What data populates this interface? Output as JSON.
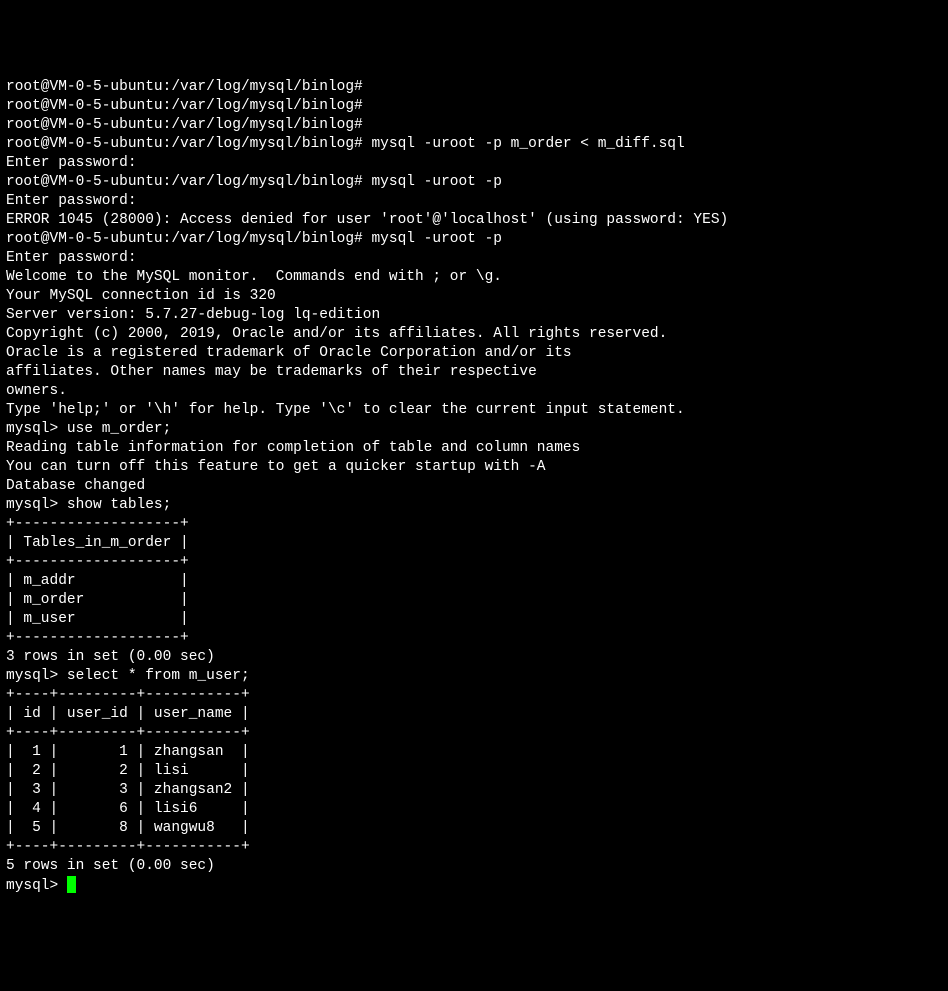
{
  "lines": [
    "root@VM-0-5-ubuntu:/var/log/mysql/binlog#",
    "root@VM-0-5-ubuntu:/var/log/mysql/binlog#",
    "root@VM-0-5-ubuntu:/var/log/mysql/binlog#",
    "root@VM-0-5-ubuntu:/var/log/mysql/binlog# mysql -uroot -p m_order < m_diff.sql",
    "Enter password:",
    "root@VM-0-5-ubuntu:/var/log/mysql/binlog# mysql -uroot -p",
    "Enter password:",
    "ERROR 1045 (28000): Access denied for user 'root'@'localhost' (using password: YES)",
    "root@VM-0-5-ubuntu:/var/log/mysql/binlog# mysql -uroot -p",
    "Enter password:",
    "Welcome to the MySQL monitor.  Commands end with ; or \\g.",
    "Your MySQL connection id is 320",
    "Server version: 5.7.27-debug-log lq-edition",
    "",
    "Copyright (c) 2000, 2019, Oracle and/or its affiliates. All rights reserved.",
    "",
    "Oracle is a registered trademark of Oracle Corporation and/or its",
    "affiliates. Other names may be trademarks of their respective",
    "owners.",
    "",
    "Type 'help;' or '\\h' for help. Type '\\c' to clear the current input statement.",
    "",
    "mysql> use m_order;",
    "Reading table information for completion of table and column names",
    "You can turn off this feature to get a quicker startup with -A",
    "",
    "Database changed",
    "mysql> show tables;",
    "+-------------------+",
    "| Tables_in_m_order |",
    "+-------------------+",
    "| m_addr            |",
    "| m_order           |",
    "| m_user            |",
    "+-------------------+",
    "3 rows in set (0.00 sec)",
    "",
    "mysql> select * from m_user;",
    "+----+---------+-----------+",
    "| id | user_id | user_name |",
    "+----+---------+-----------+",
    "|  1 |       1 | zhangsan  |",
    "|  2 |       2 | lisi      |",
    "|  3 |       3 | zhangsan2 |",
    "|  4 |       6 | lisi6     |",
    "|  5 |       8 | wangwu8   |",
    "+----+---------+-----------+",
    "5 rows in set (0.00 sec)",
    "",
    "mysql> "
  ],
  "prompt_final": "mysql> "
}
